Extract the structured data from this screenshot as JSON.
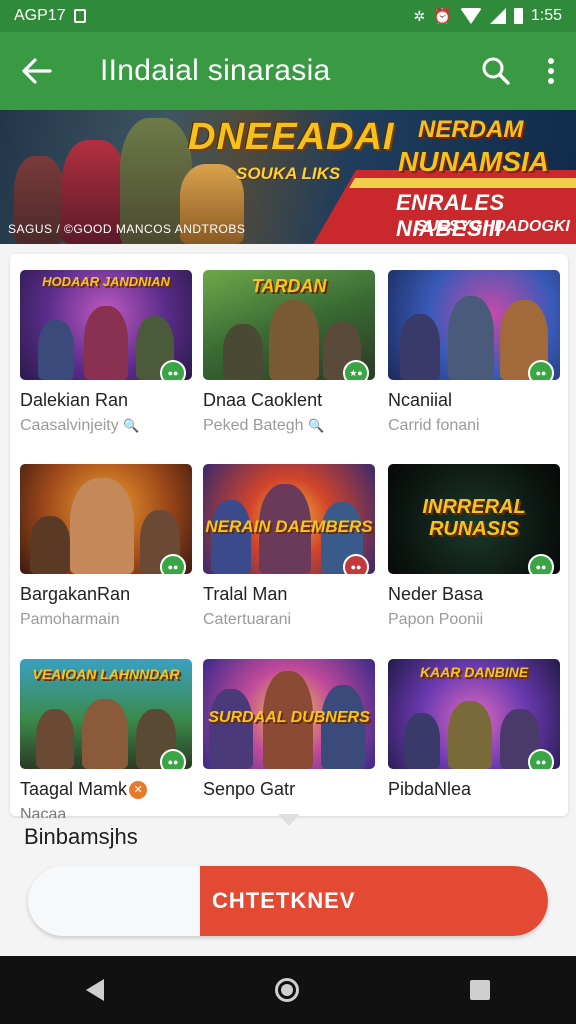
{
  "status_bar": {
    "left_text": "AGP17",
    "time": "1:55"
  },
  "app_bar": {
    "title": "IIndaial sinarasia"
  },
  "banner": {
    "headline": "DNEEADAI",
    "subheadline": "SOUKA LIKS",
    "logo_top": "NERDAM",
    "logo_bottom": "NUNAMSIA",
    "tagline": "ENRALES NIABESIII",
    "subtagline": "SUESYGHDADOGKI",
    "footer": "SAGUS / ©GOOD MANCOS ANDTROBS"
  },
  "games": [
    {
      "name": "Dalekian Ran",
      "subtitle": "Caasalvinjeity",
      "thumb_text": "HODAAR JANDNIAN",
      "badge": "●●",
      "badge_color": "green"
    },
    {
      "name": "Dnaa Caoklent",
      "subtitle": "Peked Bategh",
      "thumb_text": "TARDAN",
      "badge": "★●",
      "badge_color": "green"
    },
    {
      "name": "Ncaniial",
      "subtitle": "Carrid fonani",
      "thumb_text": "",
      "badge": "●●",
      "badge_color": "green"
    },
    {
      "name": "BargakanRan",
      "subtitle": "Pamoharmain",
      "thumb_text": "",
      "badge": "●●",
      "badge_color": "green"
    },
    {
      "name": "Tralal Man",
      "subtitle": "Catertuarani",
      "thumb_text": "NERAIN DAEMBERS",
      "badge": "●●",
      "badge_color": "red"
    },
    {
      "name": "Neder Basa",
      "subtitle": "Papon Poonii",
      "thumb_text": "INRRERAL RUNASIS",
      "badge": "●●",
      "badge_color": "green"
    },
    {
      "name": "Taagal Mamk",
      "subtitle": "Nacaa",
      "thumb_text": "VEAIOAN LAHNNDAR",
      "badge": "●●",
      "badge_color": "green"
    },
    {
      "name": "Senpo Gatr",
      "subtitle": "",
      "thumb_text": "SURDAAL DUBNERS",
      "badge": "",
      "badge_color": "green"
    },
    {
      "name": "PibdaNlea",
      "subtitle": "",
      "thumb_text": "KAAR DANBINE",
      "badge": "●●",
      "badge_color": "green"
    }
  ],
  "bottom": {
    "label": "Binbamsjhs",
    "cta_label": "CHTETKNEV"
  },
  "colors": {
    "status_bar": "#2f8a3a",
    "app_bar": "#3a9a44",
    "badge_green": "#3aa544",
    "cta_red": "#e34a33"
  }
}
